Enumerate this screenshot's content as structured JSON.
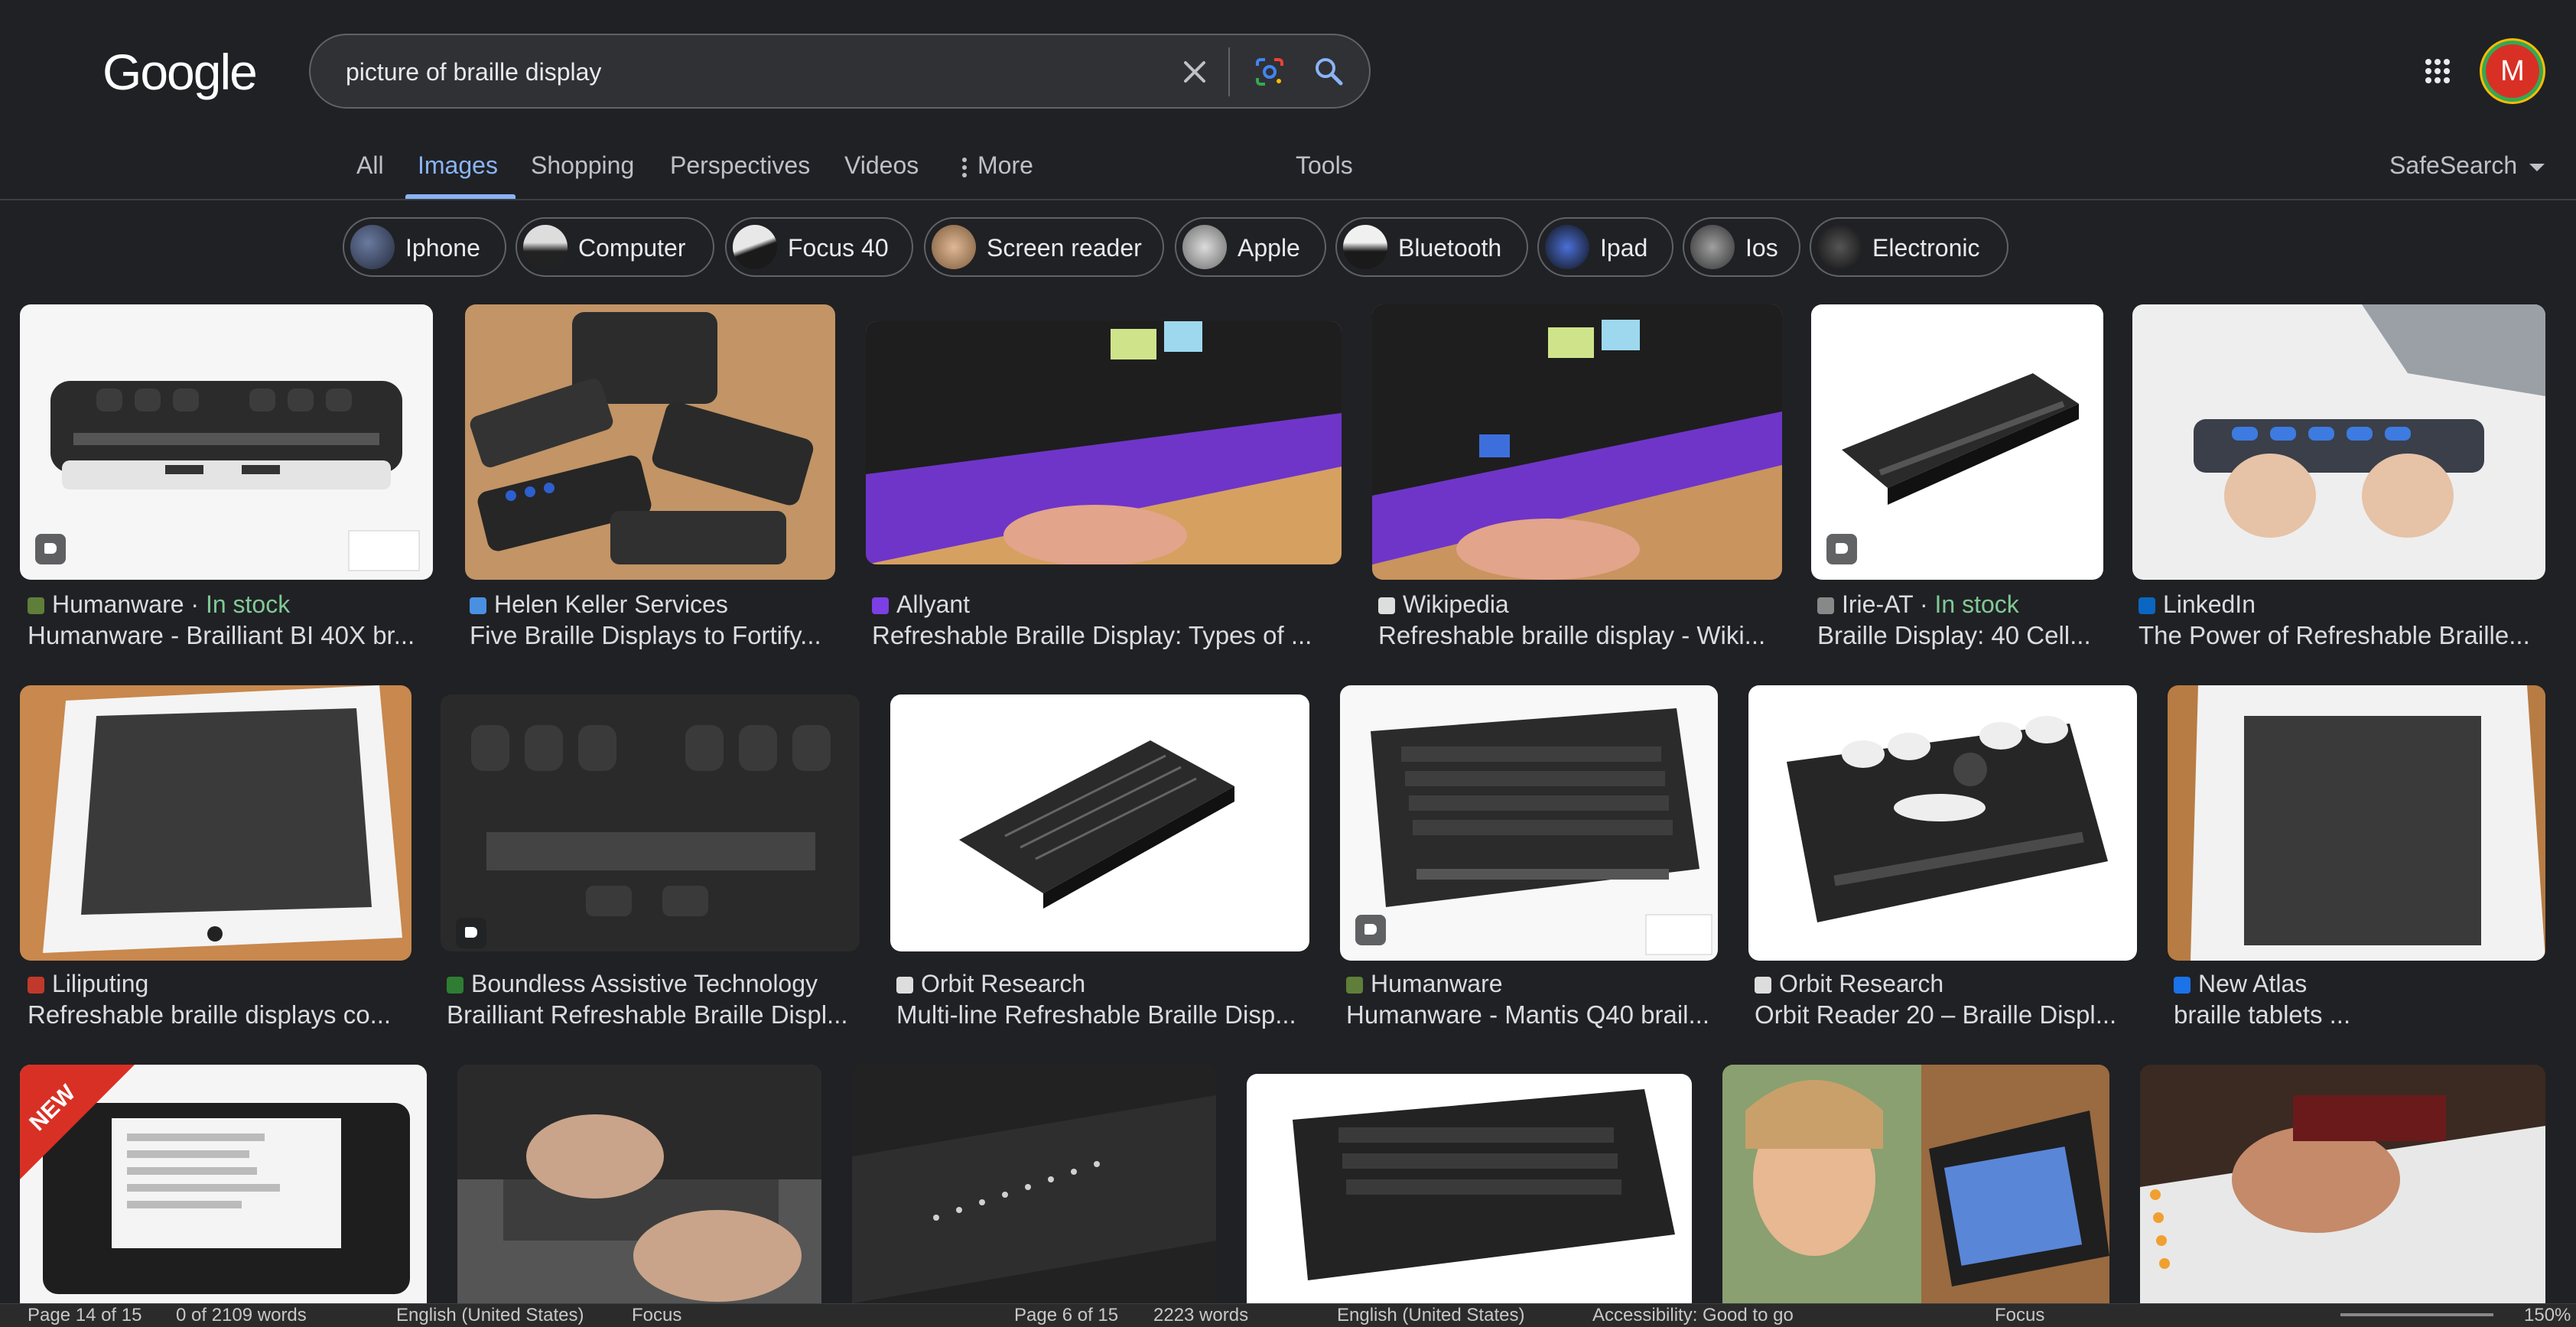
{
  "logo": "Google",
  "search": {
    "query": "picture of braille display"
  },
  "avatar_letter": "M",
  "tabs": [
    "All",
    "Images",
    "Shopping",
    "Perspectives",
    "Videos",
    "More",
    "Tools"
  ],
  "safesearch": "SafeSearch",
  "chips": [
    "Iphone",
    "Computer",
    "Focus 40",
    "Screen reader",
    "Apple",
    "Bluetooth",
    "Ipad",
    "Ios",
    "Electronic"
  ],
  "results": [
    {
      "source": "Humanware",
      "stock": "In stock",
      "title": "Humanware - Brailliant BI 40X br..."
    },
    {
      "source": "Helen Keller Services",
      "title": "Five Braille Displays to Fortify..."
    },
    {
      "source": "Allyant",
      "title": "Refreshable Braille Display: Types of ..."
    },
    {
      "source": "Wikipedia",
      "title": "Refreshable braille display - Wiki..."
    },
    {
      "source": "Irie-AT",
      "stock": "In stock",
      "title": "Braille Display: 40 Cell..."
    },
    {
      "source": "LinkedIn",
      "title": "The Power of Refreshable Braille..."
    },
    {
      "source": "Liliputing",
      "title": "Refreshable braille displays co..."
    },
    {
      "source": "Boundless Assistive Technology",
      "title": "Brailliant Refreshable Braille Displ..."
    },
    {
      "source": "Orbit Research",
      "title": "Multi-line Refreshable Braille Disp..."
    },
    {
      "source": "Humanware",
      "title": "Humanware - Mantis Q40 brail..."
    },
    {
      "source": "Orbit Research",
      "title": "Orbit Reader 20 – Braille Displ..."
    },
    {
      "source": "New Atlas",
      "title": "braille tablets ..."
    }
  ],
  "new_badge": "NEW",
  "status_bar": {
    "left": [
      "Page 14 of 15",
      "0 of 2109 words",
      "English (United States)",
      "Focus"
    ],
    "right": [
      "Page 6 of 15",
      "2223 words",
      "English (United States)",
      "Accessibility: Good to go",
      "Focus"
    ],
    "zoom": "150%"
  },
  "colors": {
    "background": "#202124",
    "accent": "#8ab4f8",
    "in_stock": "#81c995",
    "avatar": "#d93025"
  }
}
